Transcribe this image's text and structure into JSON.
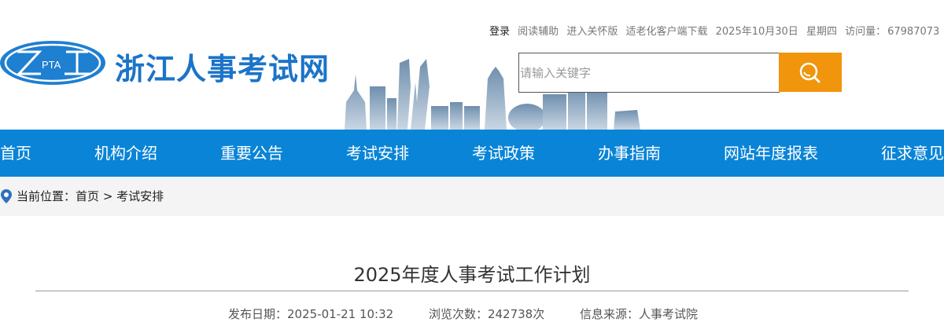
{
  "site": {
    "logo_text": "PTA",
    "name": "浙江人事考试网"
  },
  "topbar": {
    "login": "登录",
    "read_assist": "阅读辅助",
    "care_mode": "进入关怀版",
    "elder_client": "适老化客户端下载",
    "date": "2025年10月30日",
    "weekday": "星期四",
    "visit_label": "访问量：",
    "visit_count": "67987073"
  },
  "search": {
    "placeholder": "请输入关键字"
  },
  "nav": {
    "items": [
      {
        "label": "首页"
      },
      {
        "label": "机构介绍"
      },
      {
        "label": "重要公告"
      },
      {
        "label": "考试安排"
      },
      {
        "label": "考试政策"
      },
      {
        "label": "办事指南"
      },
      {
        "label": "网站年度报表"
      },
      {
        "label": "征求意见"
      }
    ]
  },
  "breadcrumb": {
    "prefix": "当前位置：",
    "home": "首页",
    "separator": ">",
    "current": "考试安排"
  },
  "article": {
    "title": "2025年度人事考试工作计划",
    "publish": "发布日期：2025-01-21 10:32",
    "views": "浏览次数：242738次",
    "source": "信息来源：人事考试院"
  },
  "colors": {
    "brand_blue": "#1b74c8",
    "nav_blue": "#0a84d6",
    "search_orange": "#f0950c"
  }
}
